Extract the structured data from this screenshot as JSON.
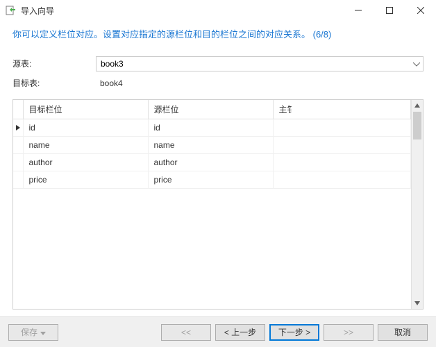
{
  "window": {
    "title": "导入向导"
  },
  "instruction": "你可以定义栏位对应。设置对应指定的源栏位和目的栏位之间的对应关系。 (6/8)",
  "form": {
    "source_label": "源表:",
    "source_value": "book3",
    "target_label": "目标表:",
    "target_value": "book4"
  },
  "table": {
    "headers": {
      "target": "目标栏位",
      "source": "源栏位",
      "primary": "主钅"
    },
    "rows": [
      {
        "target": "id",
        "source": "id",
        "current": true
      },
      {
        "target": "name",
        "source": "name",
        "current": false
      },
      {
        "target": "author",
        "source": "author",
        "current": false
      },
      {
        "target": "price",
        "source": "price",
        "current": false
      }
    ]
  },
  "footer": {
    "save": "保存",
    "first": "<<",
    "prev": "< 上一步",
    "next": "下一步 >",
    "last": ">>",
    "cancel": "取消"
  }
}
